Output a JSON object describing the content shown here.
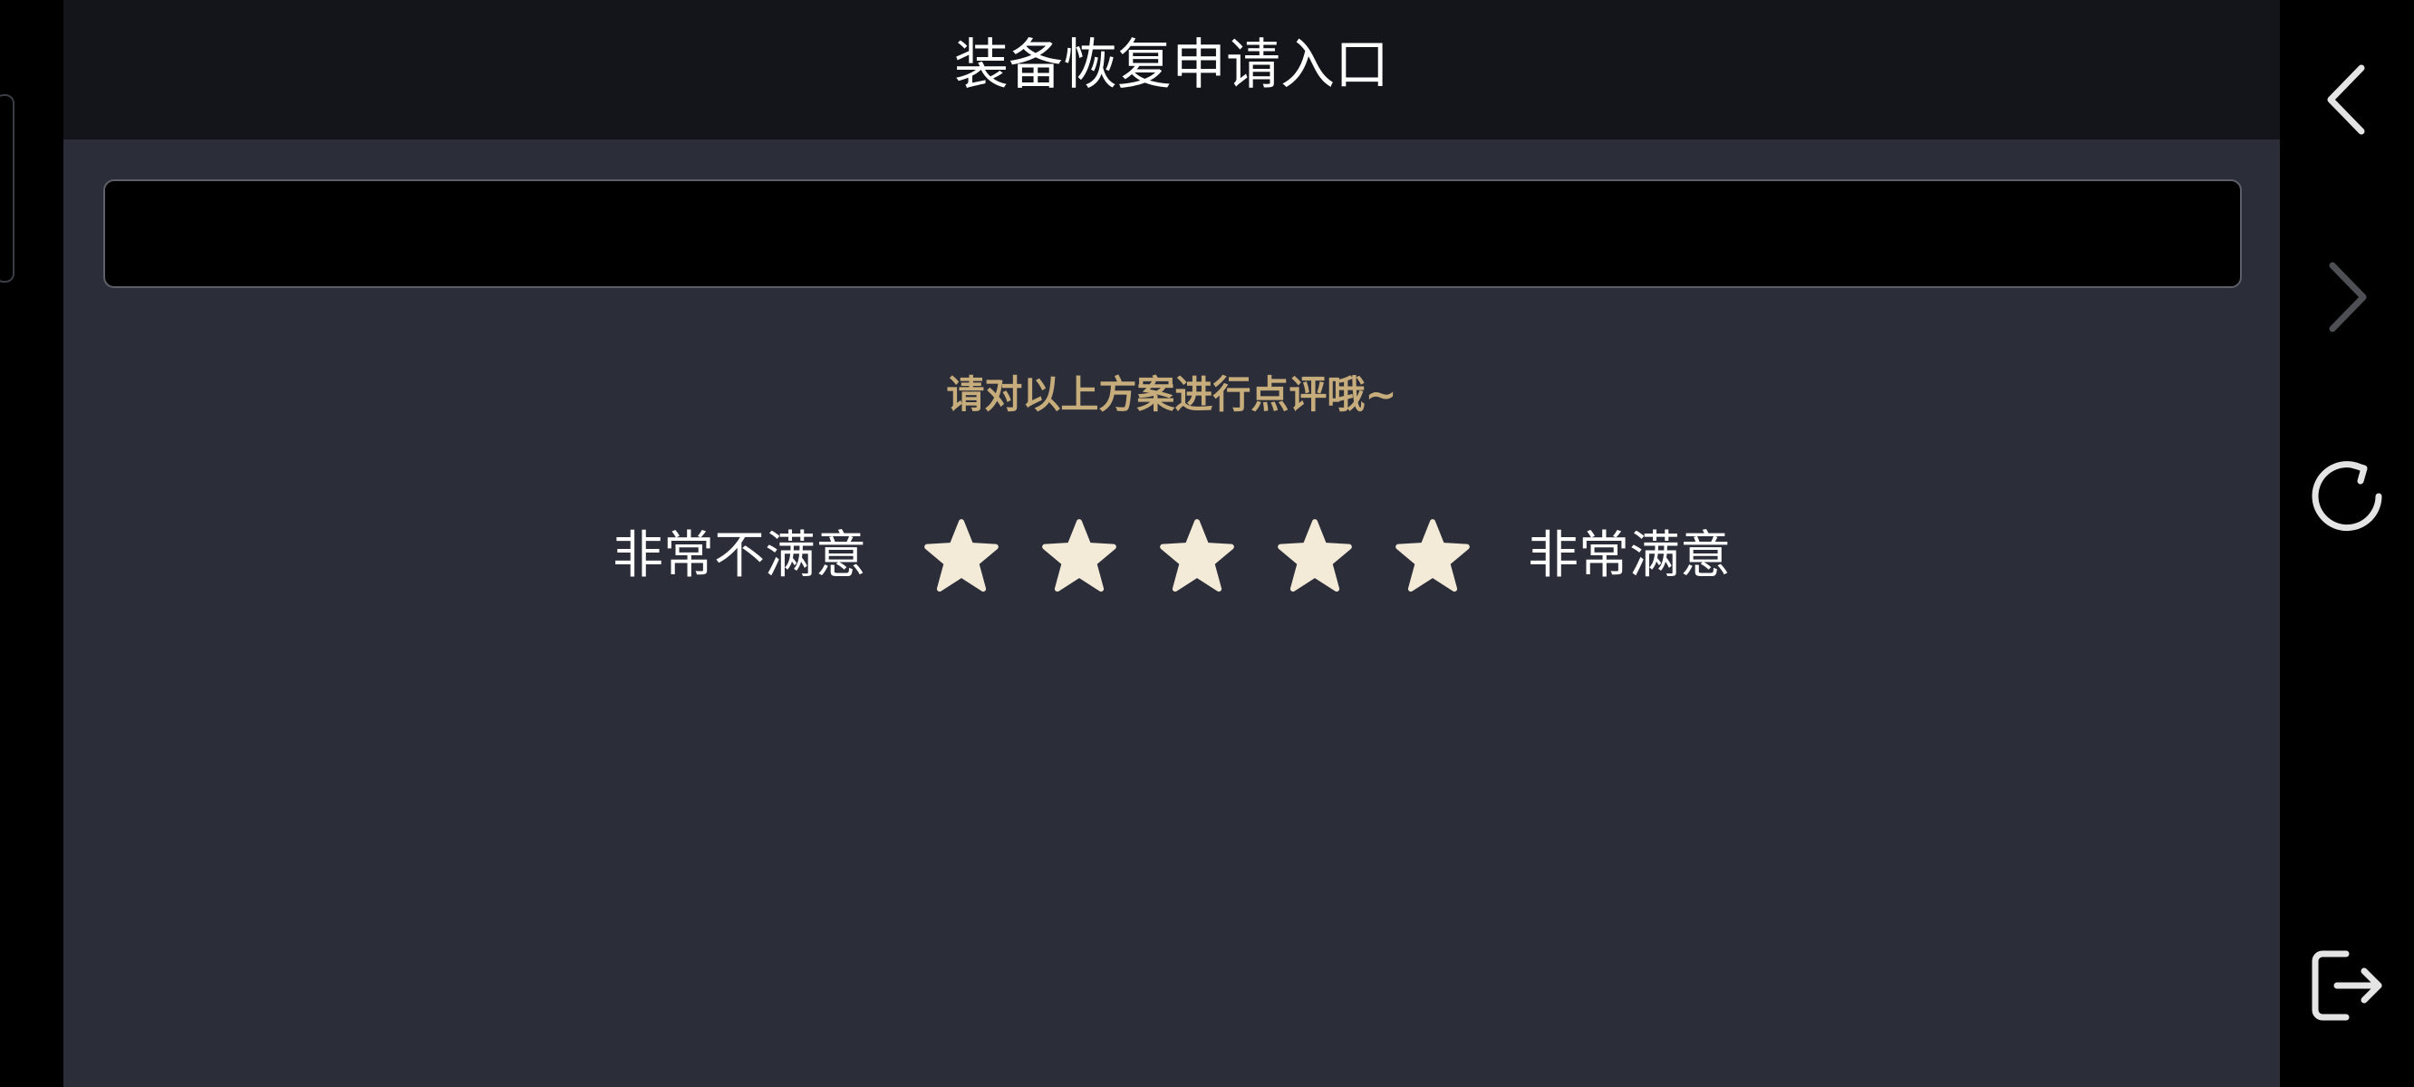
{
  "header": {
    "title": "装备恢复申请入口"
  },
  "rating": {
    "prompt": "请对以上方案进行点评哦~",
    "low_label": "非常不满意",
    "high_label": "非常满意",
    "star_count": 5,
    "star_color": "#f3ead8"
  },
  "text_box": {
    "value": ""
  },
  "side_nav": {
    "icons": [
      "back-icon",
      "forward-icon",
      "refresh-icon",
      "exit-icon"
    ]
  },
  "colors": {
    "content_bg": "#2b2e39",
    "header_bg": "#14151b",
    "prompt": "#c8ad7c"
  }
}
